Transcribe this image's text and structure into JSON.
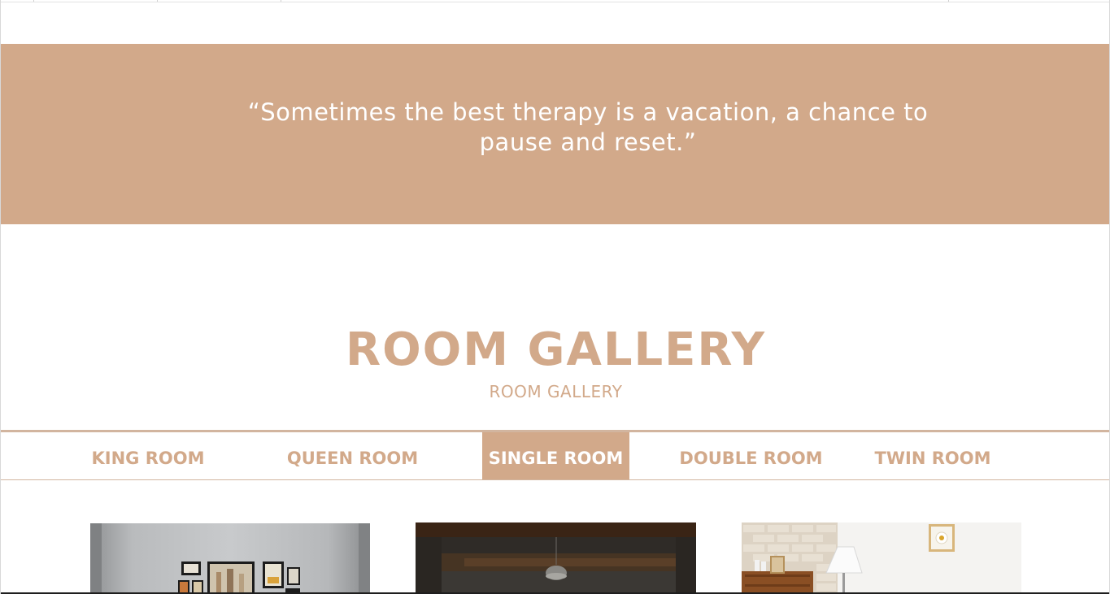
{
  "quote": {
    "text": "“Sometimes the best therapy is a vacation, a chance to pause and reset.”"
  },
  "gallery_section": {
    "title": "ROOM GALLERY",
    "subtitle": "ROOM GALLERY"
  },
  "tabs": [
    {
      "label": "KING ROOM",
      "active": false
    },
    {
      "label": "QUEEN ROOM",
      "active": false
    },
    {
      "label": "SINGLE ROOM",
      "active": true
    },
    {
      "label": "DOUBLE ROOM",
      "active": false
    },
    {
      "label": "TWIN ROOM",
      "active": false
    }
  ],
  "gallery_photos": [
    {
      "name": "room-photo-gallery-wall"
    },
    {
      "name": "room-photo-pendant-lamp"
    },
    {
      "name": "room-photo-floor-lamp"
    }
  ],
  "colors": {
    "accent": "#d2a98a",
    "white": "#ffffff"
  }
}
